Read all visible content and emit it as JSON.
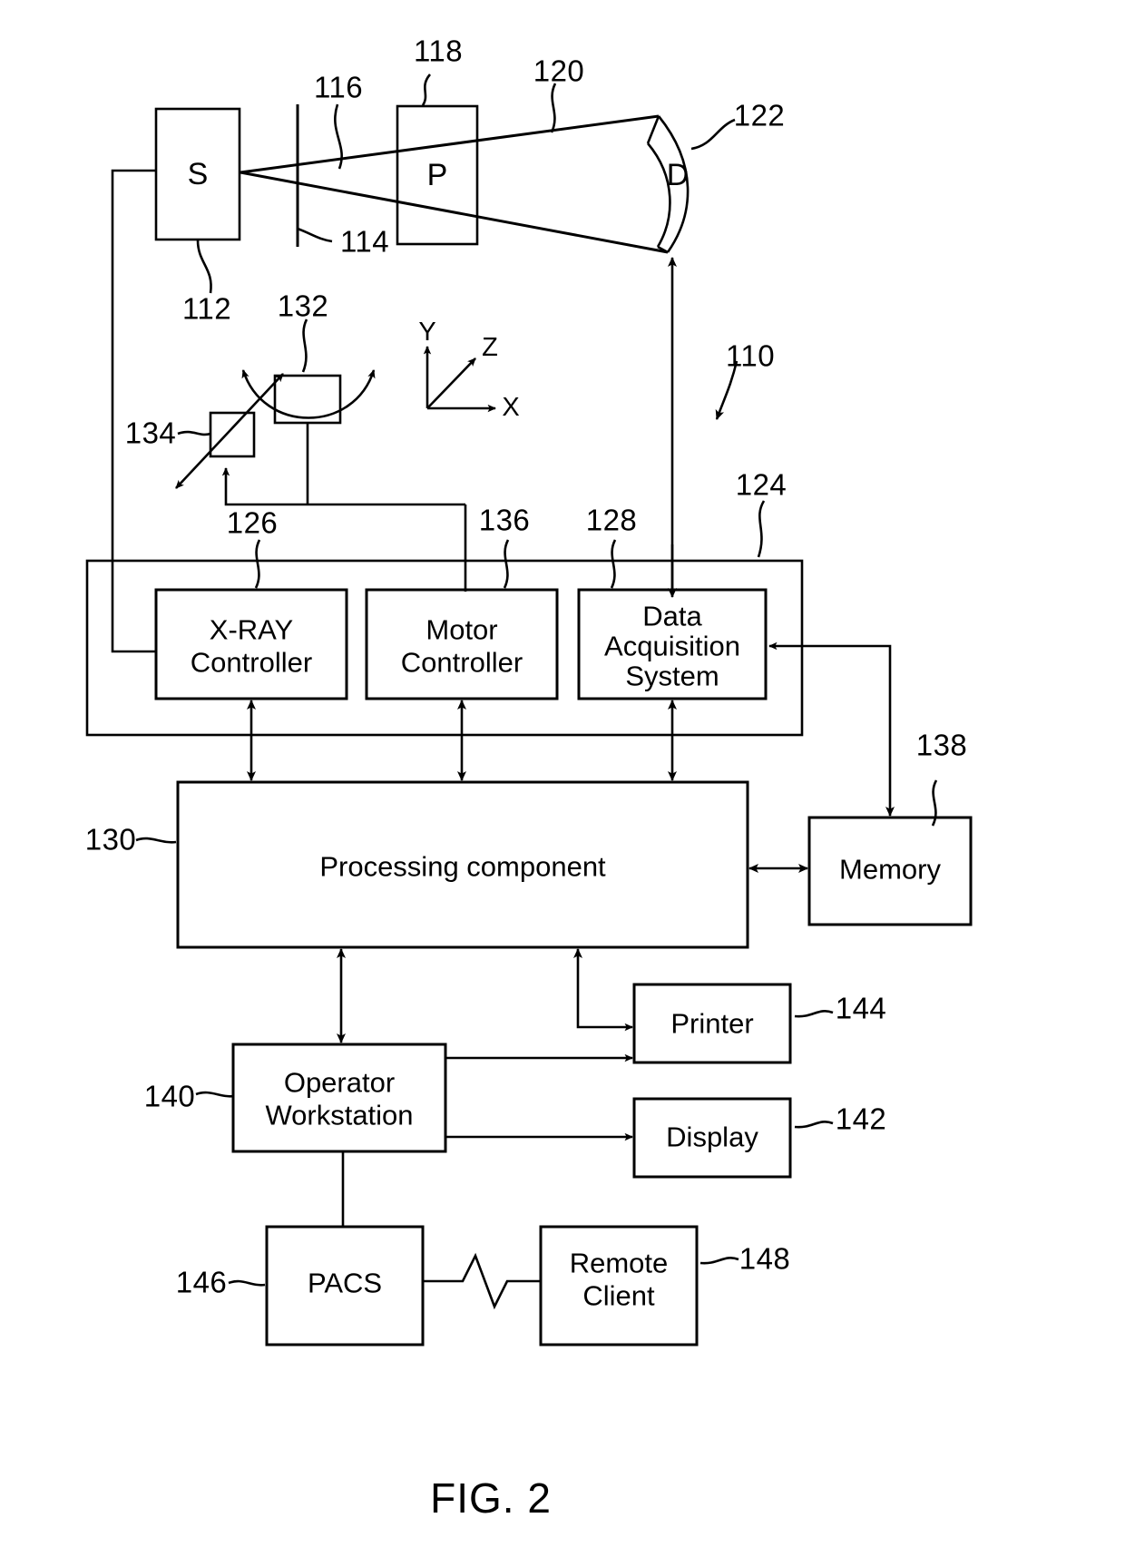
{
  "figure": {
    "caption": "FIG. 2",
    "title_glyphs": {
      "source": "S",
      "patient": "P",
      "detector": "D"
    },
    "axes": {
      "y": "Y",
      "z": "Z",
      "x": "X"
    }
  },
  "blocks": [
    {
      "id": "xray_controller",
      "label": "X-RAY\nController",
      "line1": "X-RAY",
      "line2": "Controller"
    },
    {
      "id": "motor_controller",
      "label": "Motor\nController",
      "line1": "Motor",
      "line2": "Controller"
    },
    {
      "id": "data_acquisition_system",
      "label": "Data\nAcquisition\nSystem",
      "line1": "Data",
      "line2": "Acquisition",
      "line3": "System"
    },
    {
      "id": "processing_component",
      "label": "Processing component"
    },
    {
      "id": "memory",
      "label": "Memory"
    },
    {
      "id": "printer",
      "label": "Printer"
    },
    {
      "id": "display",
      "label": "Display"
    },
    {
      "id": "operator_workstation",
      "label": "Operator\nWorkstation",
      "line1": "Operator",
      "line2": "Workstation"
    },
    {
      "id": "pacs",
      "label": "PACS"
    },
    {
      "id": "remote_client",
      "label": "Remote\nClient",
      "line1": "Remote",
      "line2": "Client"
    }
  ],
  "reference_numerals": {
    "n110": "110",
    "n112": "112",
    "n114": "114",
    "n116": "116",
    "n118": "118",
    "n120": "120",
    "n122": "122",
    "n124": "124",
    "n126": "126",
    "n128": "128",
    "n130": "130",
    "n132": "132",
    "n134": "134",
    "n136": "136",
    "n138": "138",
    "n140": "140",
    "n142": "142",
    "n144": "144",
    "n146": "146",
    "n148": "148"
  },
  "colors": {
    "stroke": "#000000",
    "background": "#ffffff"
  }
}
